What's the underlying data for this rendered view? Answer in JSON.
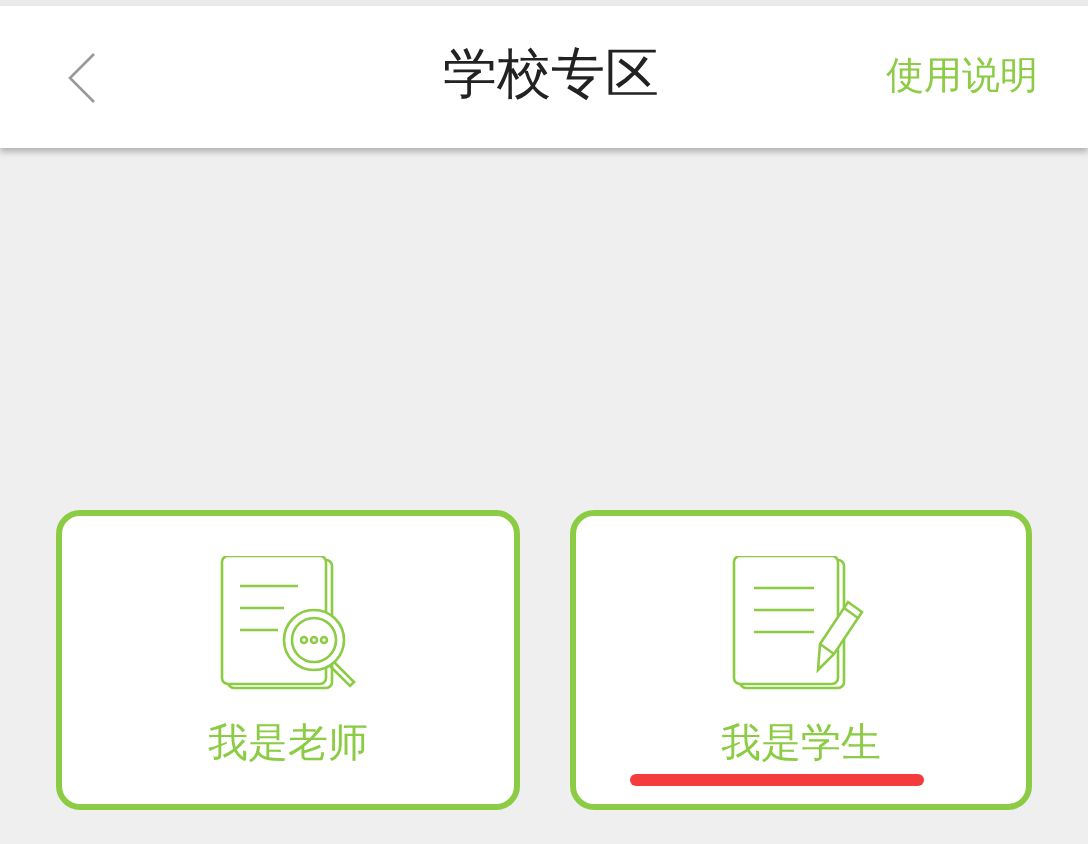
{
  "header": {
    "title": "学校专区",
    "help_link": "使用说明"
  },
  "cards": [
    {
      "kind": "search",
      "label": "我是老师",
      "underlined": false
    },
    {
      "kind": "pencil",
      "label": "我是学生",
      "underlined": true
    }
  ]
}
